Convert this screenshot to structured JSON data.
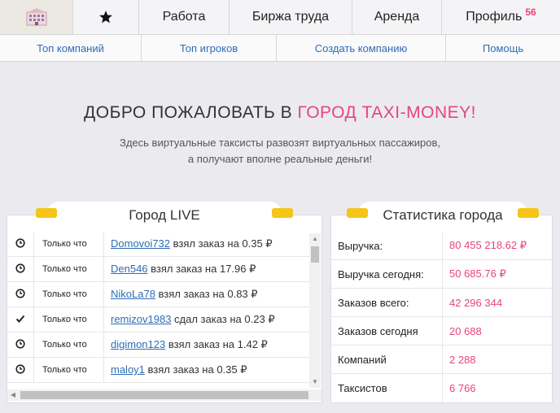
{
  "topnav": {
    "home_icon": "city-building-icon",
    "fav_icon": "star-icon",
    "work": "Работа",
    "exchange": "Биржа труда",
    "rent": "Аренда",
    "profile": "Профиль",
    "profile_badge": "56"
  },
  "subnav": {
    "top_companies": "Топ компаний",
    "top_players": "Топ игроков",
    "create_company": "Создать компанию",
    "help": "Помощь"
  },
  "hero": {
    "title_prefix": "ДОБРО ПОЖАЛОВАТЬ В",
    "title_accent": "ГОРОД TAXI-MONEY!",
    "line1": "Здесь виртуальные таксисты развозят виртуальных пассажиров,",
    "line2": "а получают вполне реальные деньги!"
  },
  "live": {
    "title": "Город LIVE",
    "rows": [
      {
        "icon": "clock-icon",
        "time": "Только что",
        "user": "Domovoi732",
        "text": " взял заказ на 0.35 ₽"
      },
      {
        "icon": "clock-icon",
        "time": "Только что",
        "user": "Den546",
        "text": " взял заказ на 17.96 ₽"
      },
      {
        "icon": "clock-icon",
        "time": "Только что",
        "user": "NikoLa78",
        "text": " взял заказ на 0.83 ₽"
      },
      {
        "icon": "check-icon",
        "time": "Только что",
        "user": "remizov1983",
        "text": " сдал заказ на 0.23 ₽"
      },
      {
        "icon": "clock-icon",
        "time": "Только что",
        "user": "digimon123",
        "text": " взял заказ на 1.42 ₽"
      },
      {
        "icon": "clock-icon",
        "time": "Только что",
        "user": "maloy1",
        "text": " взял заказ на 0.35 ₽"
      }
    ]
  },
  "stats": {
    "title": "Статистика города",
    "rows": [
      {
        "label": "Выручка:",
        "value": "80 455 218.62 ₽"
      },
      {
        "label": "Выручка сегодня:",
        "value": "50 685.76 ₽"
      },
      {
        "label": "Заказов всего:",
        "value": "42 296 344"
      },
      {
        "label": "Заказов сегодня",
        "value": "20 688"
      },
      {
        "label": "Компаний",
        "value": "2 288"
      },
      {
        "label": "Таксистов",
        "value": "6 766"
      }
    ]
  }
}
